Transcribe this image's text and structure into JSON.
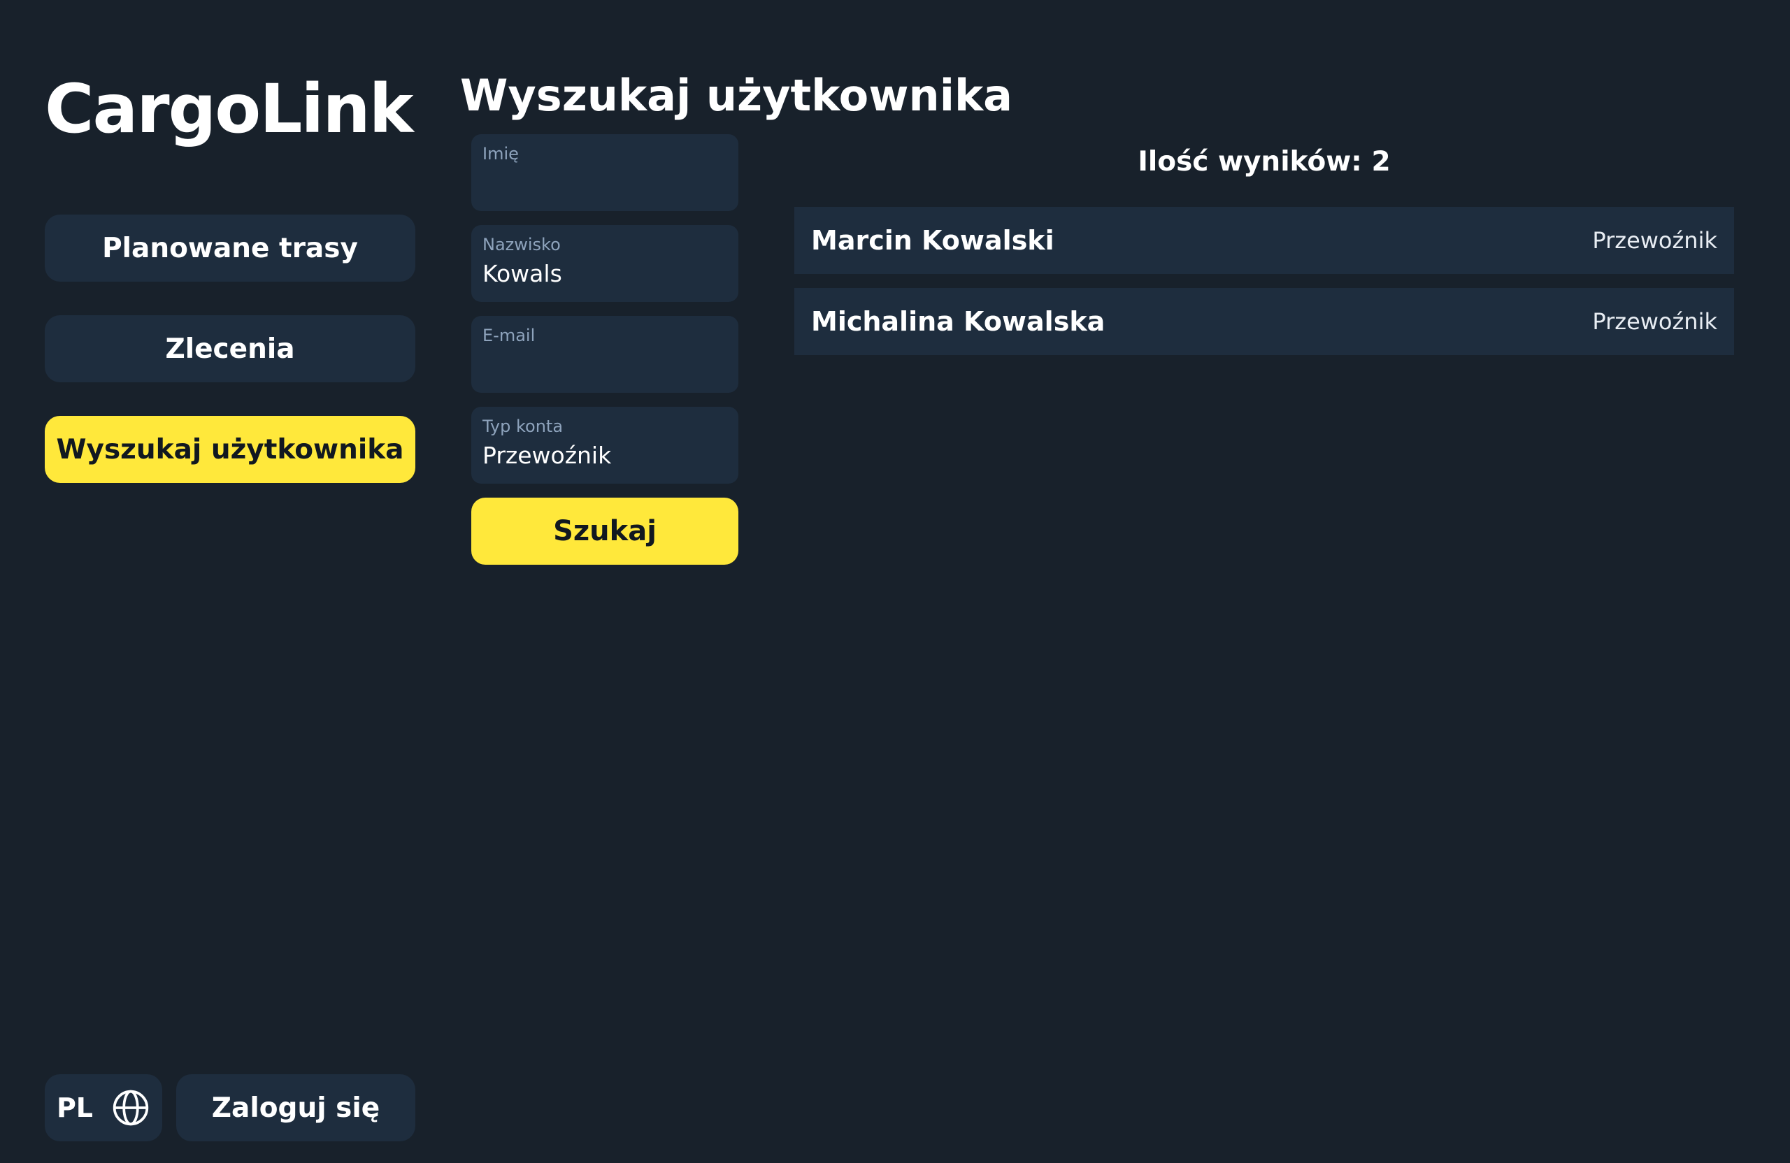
{
  "app": {
    "name": "CargoLink"
  },
  "sidebar": {
    "items": [
      {
        "label": "Planowane trasy",
        "active": false
      },
      {
        "label": "Zlecenia",
        "active": false
      },
      {
        "label": "Wyszukaj użytkownika",
        "active": true
      }
    ],
    "language": {
      "label": "PL",
      "icon": "globe-icon"
    },
    "login_label": "Zaloguj się"
  },
  "main": {
    "title": "Wyszukaj użytkownika",
    "form": {
      "first_name": {
        "label": "Imię",
        "value": ""
      },
      "last_name": {
        "label": "Nazwisko",
        "value": "Kowals"
      },
      "email": {
        "label": "E-mail",
        "value": ""
      },
      "account_type": {
        "label": "Typ konta",
        "value": "Przewoźnik"
      },
      "submit_label": "Szukaj"
    },
    "results": {
      "count_label": "Ilość wyników: 2",
      "rows": [
        {
          "name": "Marcin Kowalski",
          "type": "Przewoźnik"
        },
        {
          "name": "Michalina Kowalska",
          "type": "Przewoźnik"
        }
      ]
    }
  },
  "colors": {
    "background": "#18212b",
    "surface": "#1e2d3e",
    "accent": "#ffe83b",
    "label": "#8ea3bc"
  }
}
